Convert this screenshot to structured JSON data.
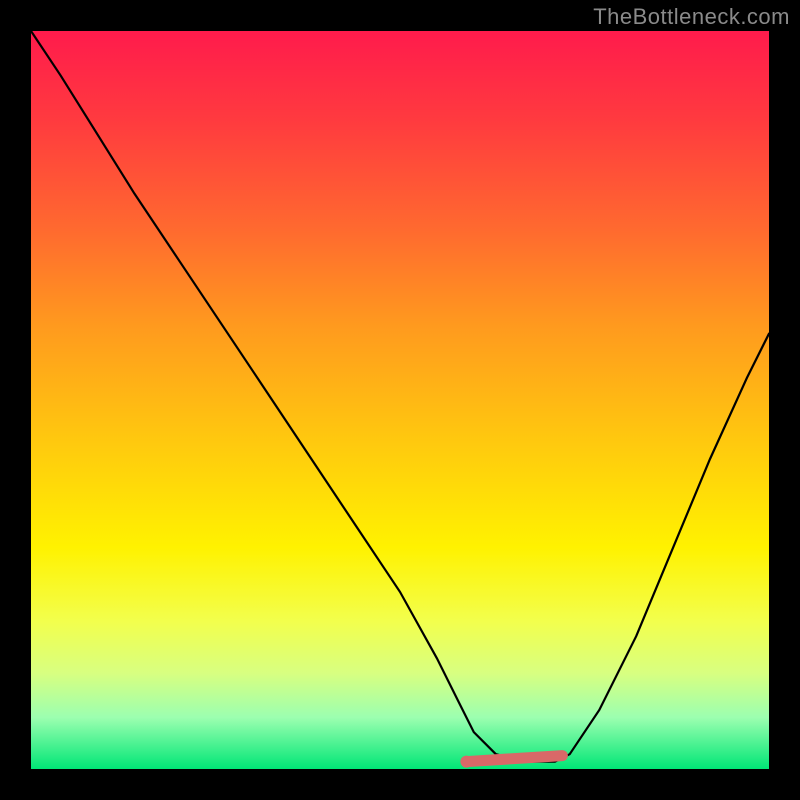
{
  "watermark": "TheBottleneck.com",
  "chart_data": {
    "type": "line",
    "title": "",
    "xlabel": "",
    "ylabel": "",
    "xlim": [
      0,
      100
    ],
    "ylim": [
      0,
      100
    ],
    "grid": false,
    "legend": false,
    "series": [
      {
        "name": "bottleneck-curve",
        "color": "#000000",
        "x": [
          0,
          4,
          9,
          14,
          20,
          26,
          32,
          38,
          44,
          50,
          55,
          58,
          60,
          63,
          67,
          71,
          73,
          77,
          82,
          87,
          92,
          97,
          100
        ],
        "y": [
          100,
          94,
          86,
          78,
          69,
          60,
          51,
          42,
          33,
          24,
          15,
          9,
          5,
          2,
          1,
          1,
          2,
          8,
          18,
          30,
          42,
          53,
          59
        ]
      }
    ],
    "annotations": [
      {
        "name": "optimal-flat-region",
        "color": "#d96868",
        "x_start": 59,
        "x_end": 72,
        "y": 1
      }
    ],
    "background_gradient": {
      "top": "#ff1b4c",
      "mid": "#fff200",
      "bottom": "#00e676"
    }
  }
}
